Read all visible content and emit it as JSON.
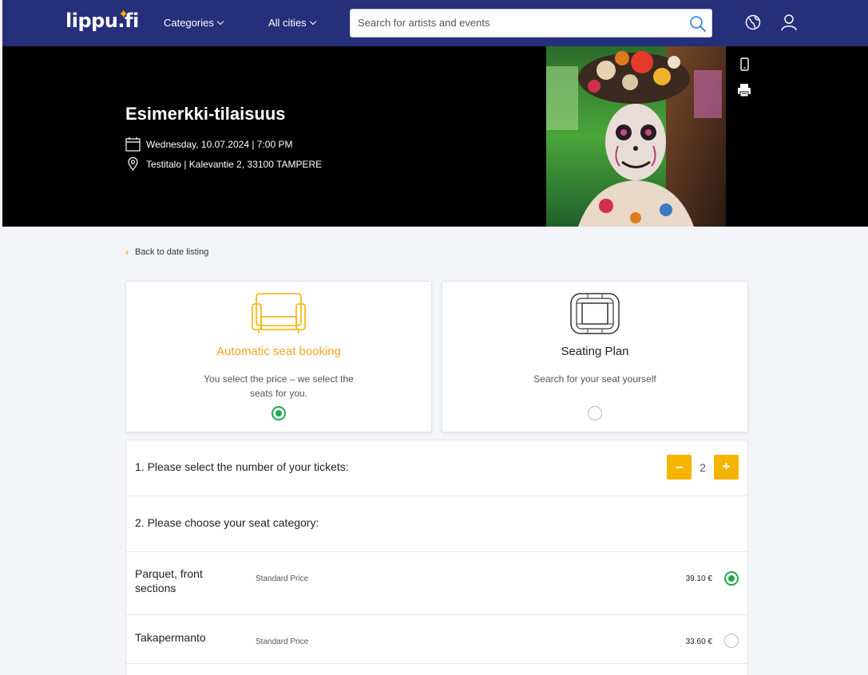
{
  "header": {
    "logo": "lippu.fi",
    "nav": [
      {
        "label": "Categories"
      },
      {
        "label": "All cities"
      }
    ],
    "search_placeholder": "Search for artists and events"
  },
  "event": {
    "title": "Esimerkki-tilaisuus",
    "date": "Wednesday, 10.07.2024 | 7:00 PM",
    "venue": "Testitalo | Kalevantie 2, 33100 TAMPERE"
  },
  "back_link": "Back to date listing",
  "booking_modes": [
    {
      "title": "Automatic seat booking",
      "description": "You select the price – we select the seats for you.",
      "selected": true,
      "icon": "armchair-icon"
    },
    {
      "title": "Seating Plan",
      "description": "Search for your seat yourself",
      "selected": false,
      "icon": "seating-plan-icon"
    }
  ],
  "tickets": {
    "step1_label": "1. Please select the number of your tickets:",
    "quantity": "2",
    "minus_label": "–",
    "plus_label": "+",
    "step2_label": "2. Please choose your seat category:"
  },
  "categories": [
    {
      "name": "Parquet, front sections",
      "price_type": "Standard Price",
      "price": "39.10 €",
      "selected": true
    },
    {
      "name": "Takapermanto",
      "price_type": "Standard Price",
      "price": "33.60 €",
      "selected": false
    }
  ],
  "colors": {
    "nav_bg": "#252f7a",
    "accent": "#f5b400",
    "selected_green": "#1faa4b"
  }
}
